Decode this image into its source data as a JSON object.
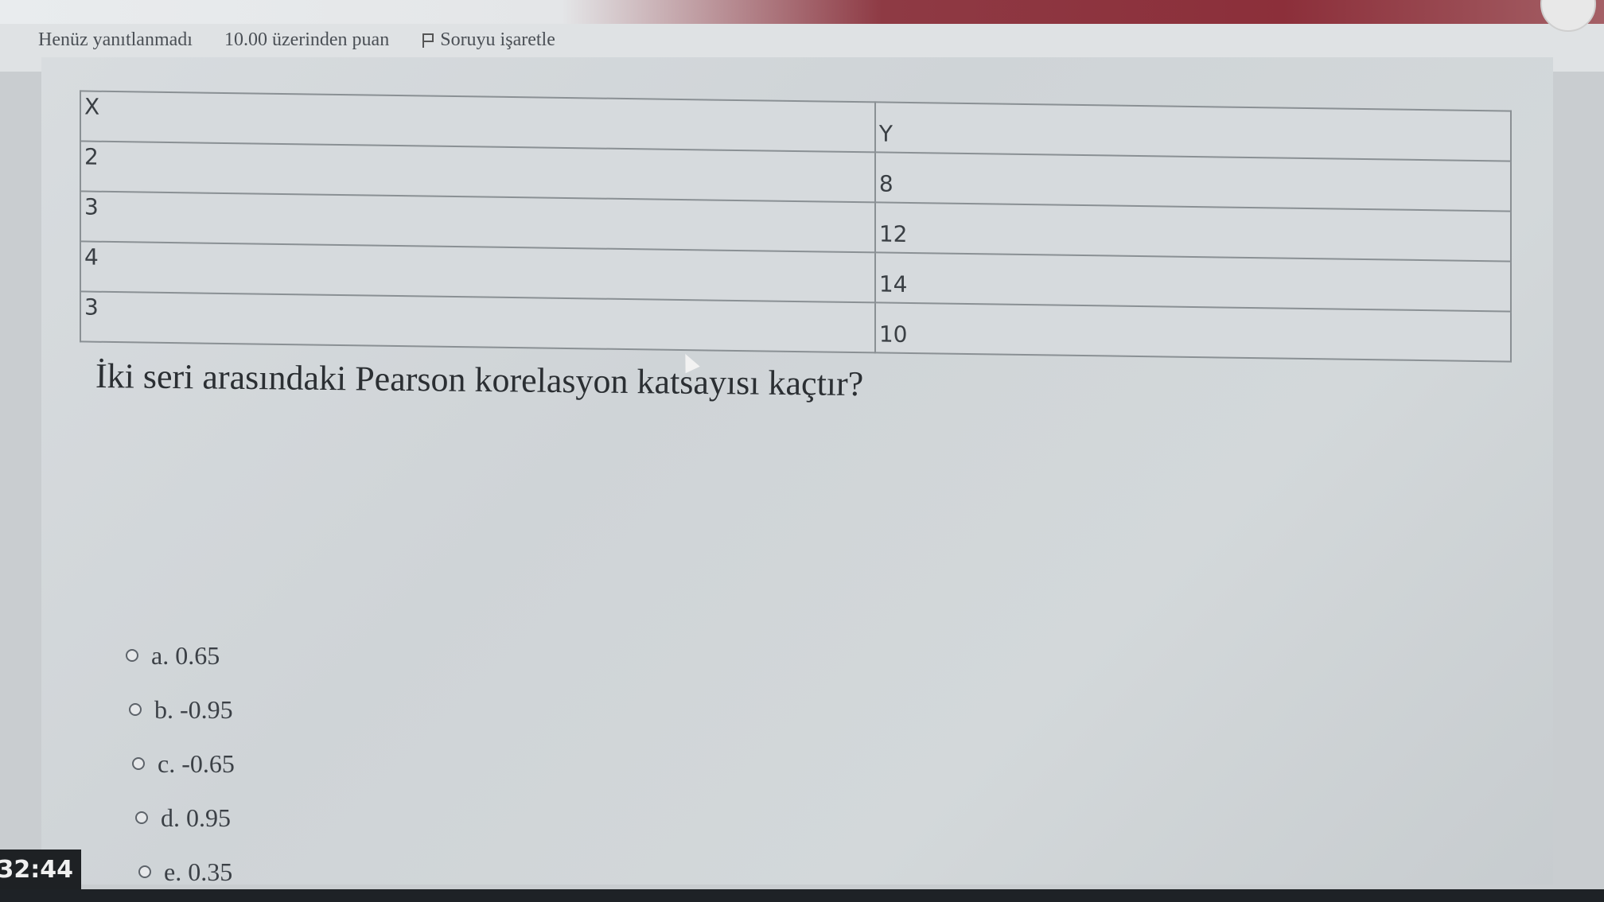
{
  "question_meta": {
    "status": "Henüz yanıtlanmadı",
    "points": "10.00 üzerinden puan",
    "flag_label": "Soruyu işaretle"
  },
  "table": {
    "header": [
      "X",
      "Y"
    ],
    "rows": [
      [
        "2",
        "8"
      ],
      [
        "3",
        "12"
      ],
      [
        "4",
        "14"
      ],
      [
        "3",
        "10"
      ]
    ]
  },
  "question_text": "İki seri arasındaki Pearson korelasyon katsayısı kaçtır?",
  "options": [
    {
      "letter": "a.",
      "value": "0.65"
    },
    {
      "letter": "b.",
      "value": "-0.95"
    },
    {
      "letter": "c.",
      "value": "-0.65"
    },
    {
      "letter": "d.",
      "value": "0.95"
    },
    {
      "letter": "e.",
      "value": "0.35"
    }
  ],
  "timer": "32:44"
}
